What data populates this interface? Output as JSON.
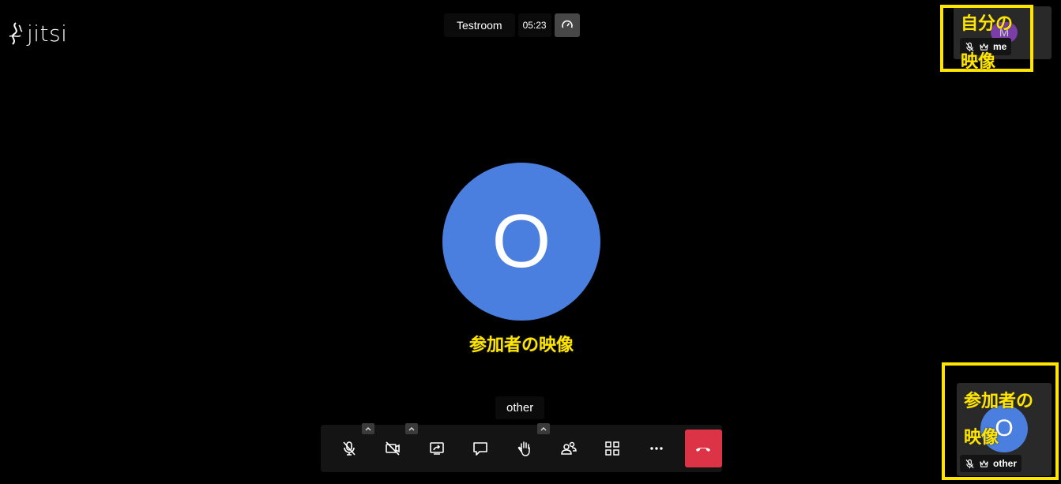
{
  "logo": {
    "text": "jitsi"
  },
  "header": {
    "room_name": "Testroom",
    "timer": "05:23"
  },
  "stage": {
    "avatar_initial": "O",
    "speaker_name": "other"
  },
  "annotations": {
    "main": "参加者の映像",
    "self_line1": "自分の",
    "self_line2": "映像",
    "other_line1": "参加者の",
    "other_line2": "映像"
  },
  "toolbar": {
    "items": [
      {
        "icon": "microphone-muted-icon",
        "has_caret": true
      },
      {
        "icon": "camera-off-icon",
        "has_caret": true
      },
      {
        "icon": "screen-share-icon",
        "has_caret": false
      },
      {
        "icon": "chat-icon",
        "has_caret": false
      },
      {
        "icon": "raise-hand-icon",
        "has_caret": true
      },
      {
        "icon": "participants-icon",
        "has_caret": false
      },
      {
        "icon": "tile-view-icon",
        "has_caret": false
      },
      {
        "icon": "more-icon",
        "has_caret": false
      }
    ],
    "hangup_icon": "hangup-icon",
    "hangup_color": "#dd3347"
  },
  "thumbnails": {
    "self": {
      "initial": "M",
      "name": "me",
      "avatar_color": "#7b3ea8"
    },
    "other": {
      "initial": "O",
      "name": "other",
      "avatar_color": "#4a7fdf"
    }
  },
  "colors": {
    "annotation": "#ffe500",
    "avatar_blue": "#4a7fdf",
    "background": "#000000"
  }
}
